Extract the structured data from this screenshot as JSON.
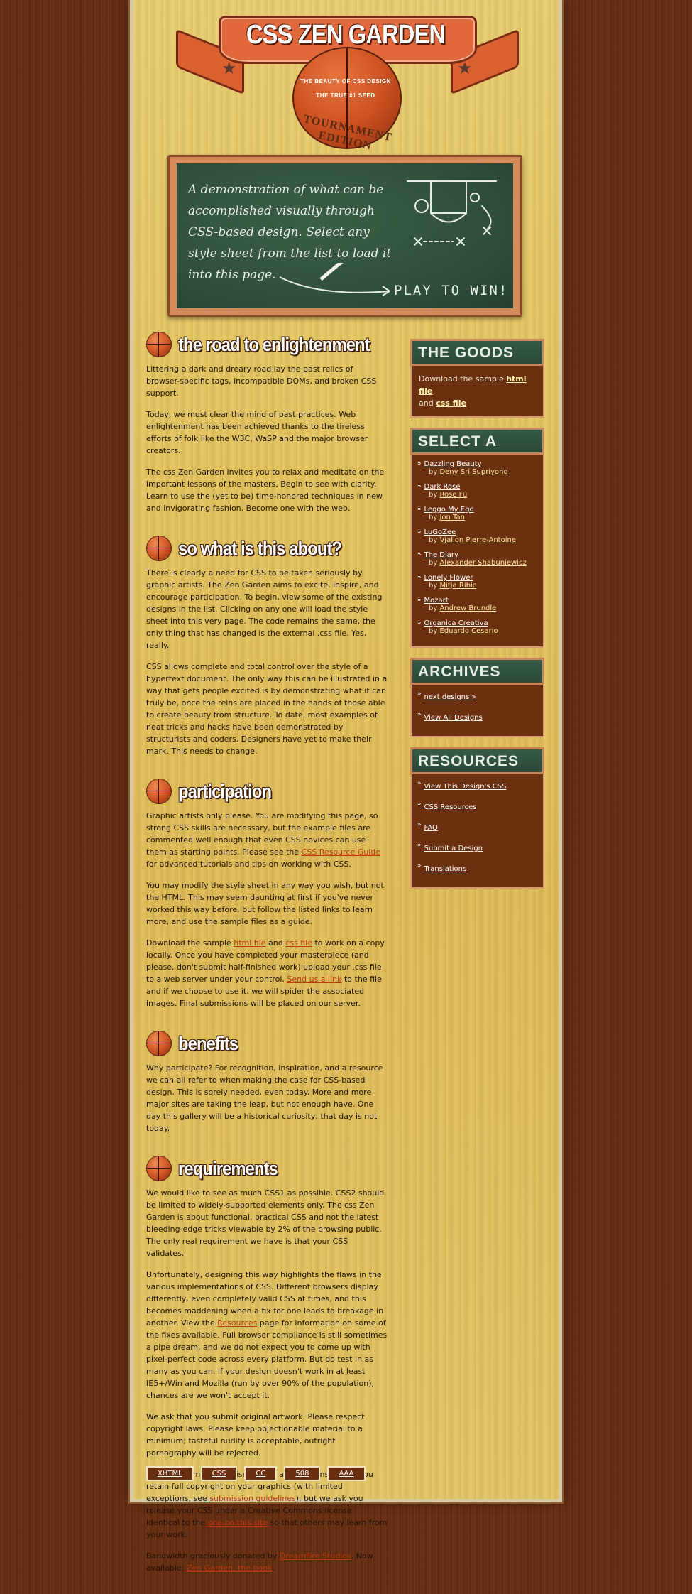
{
  "header": {
    "title": "CSS ZEN GARDEN",
    "tagline1": "THE BEAUTY OF CSS DESIGN",
    "tagline2": "THE TRUE #1 SEED",
    "edition": "TOURNAMENT EDITION"
  },
  "chalkboard": {
    "text": "A demonstration of what can be accomplished visually through CSS-based design. Select any style sheet from the list to load it into this page.",
    "play": "PLAY TO WIN!"
  },
  "sections": [
    {
      "title": "the road to enlightenment",
      "paragraphs": [
        "Littering a dark and dreary road lay the past relics of browser-specific tags, incompatible DOMs, and broken CSS support.",
        "Today, we must clear the mind of past practices. Web enlightenment has been achieved thanks to the tireless efforts of folk like the W3C, WaSP and the major browser creators.",
        "The css Zen Garden invites you to relax and meditate on the important lessons of the masters. Begin to see with clarity. Learn to use the (yet to be) time-honored techniques in new and invigorating fashion. Become one with the web."
      ]
    },
    {
      "title": "so what is this about?",
      "paragraphs": [
        "There is clearly a need for CSS to be taken seriously by graphic artists. The Zen Garden aims to excite, inspire, and encourage participation. To begin, view some of the existing designs in the list. Clicking on any one will load the style sheet into this very page. The code remains the same, the only thing that has changed is the external .css file. Yes, really.",
        "CSS allows complete and total control over the style of a hypertext document. The only way this can be illustrated in a way that gets people excited is by demonstrating what it can truly be, once the reins are placed in the hands of those able to create beauty from structure. To date, most examples of neat tricks and hacks have been demonstrated by structurists and coders. Designers have yet to make their mark. This needs to change."
      ]
    },
    {
      "title": "participation",
      "p1_before": "Graphic artists only please. You are modifying this page, so strong CSS skills are necessary, but the example files are commented well enough that even CSS novices can use them as starting points. Please see the ",
      "p1_link": "CSS Resource Guide",
      "p1_after": " for advanced tutorials and tips on working with CSS.",
      "p2": "You may modify the style sheet in any way you wish, but not the HTML. This may seem daunting at first if you've never worked this way before, but follow the listed links to learn more, and use the sample files as a guide.",
      "p3_a": "Download the sample ",
      "p3_link1": "html file",
      "p3_b": " and ",
      "p3_link2": "css file",
      "p3_c": " to work on a copy locally. Once you have completed your masterpiece (and please, don't submit half-finished work) upload your .css file to a web server under your control. ",
      "p3_link3": "Send us a link",
      "p3_d": " to the file and if we choose to use it, we will spider the associated images. Final submissions will be placed on our server."
    },
    {
      "title": "benefits",
      "paragraphs": [
        "Why participate? For recognition, inspiration, and a resource we can all refer to when making the case for CSS-based design. This is sorely needed, even today. More and more major sites are taking the leap, but not enough have. One day this gallery will be a historical curiosity; that day is not today."
      ]
    },
    {
      "title": "requirements",
      "p1": "We would like to see as much CSS1 as possible. CSS2 should be limited to widely-supported elements only. The css Zen Garden is about functional, practical CSS and not the latest bleeding-edge tricks viewable by 2% of the browsing public. The only real requirement we have is that your CSS validates.",
      "p2_before": "Unfortunately, designing this way highlights the flaws in the various implementations of CSS. Different browsers display differently, even completely valid CSS at times, and this becomes maddening when a fix for one leads to breakage in another. View the ",
      "p2_link": "Resources",
      "p2_after": " page for information on some of the fixes available. Full browser compliance is still sometimes a pipe dream, and we do not expect you to come up with pixel-perfect code across every platform. But do test in as many as you can. If your design doesn't work in at least IE5+/Win and Mozilla (run by over 90% of the population), chances are we won't accept it.",
      "p3": "We ask that you submit original artwork. Please respect copyright laws. Please keep objectionable material to a minimum; tasteful nudity is acceptable, outright pornography will be rejected.",
      "p4_a": "This is a learning exercise as well as a demonstration. You retain full copyright on your graphics (with limited exceptions, see ",
      "p4_link1": "submission guidelines",
      "p4_b": "), but we ask you release your CSS under a Creative Commons license identical to the ",
      "p4_link2": "one on this site",
      "p4_c": " so that others may learn from your work.",
      "p5_a": "Bandwidth graciously donated by ",
      "p5_link1": "DreamFire Studios",
      "p5_b": ". Now available: ",
      "p5_link2": "Zen Garden, the book",
      "p5_c": "."
    }
  ],
  "footer": [
    "XHTML",
    "CSS",
    "CC",
    "508",
    "AAA"
  ],
  "sidebar": {
    "goods": {
      "heading": "THE GOODS",
      "text_a": "Download the sample ",
      "link1": "html file",
      "text_b": " and ",
      "link2": "css file"
    },
    "select": {
      "heading": "SELECT A DESIGN",
      "by": "by",
      "designs": [
        {
          "name": "Dazzling Beauty",
          "author": "Deny Sri Supriyono"
        },
        {
          "name": "Dark Rose",
          "author": "Rose Fu"
        },
        {
          "name": "Leggo My Ego",
          "author": "Jon Tan"
        },
        {
          "name": "LuGoZee",
          "author": "Vjallon Pierre-Antoine"
        },
        {
          "name": "The Diary",
          "author": "Alexander Shabuniewicz"
        },
        {
          "name": "Lonely Flower",
          "author": "Mitja Ribic"
        },
        {
          "name": "Mozart",
          "author": "Andrew Brundle"
        },
        {
          "name": "Organica Creativa",
          "author": "Eduardo Cesario"
        }
      ]
    },
    "archives": {
      "heading": "ARCHIVES",
      "items": [
        "next designs »",
        "View All Designs"
      ]
    },
    "resources": {
      "heading": "RESOURCES",
      "items": [
        "View This Design's CSS",
        "CSS Resources",
        "FAQ",
        "Submit a Design",
        "Translations"
      ]
    }
  }
}
